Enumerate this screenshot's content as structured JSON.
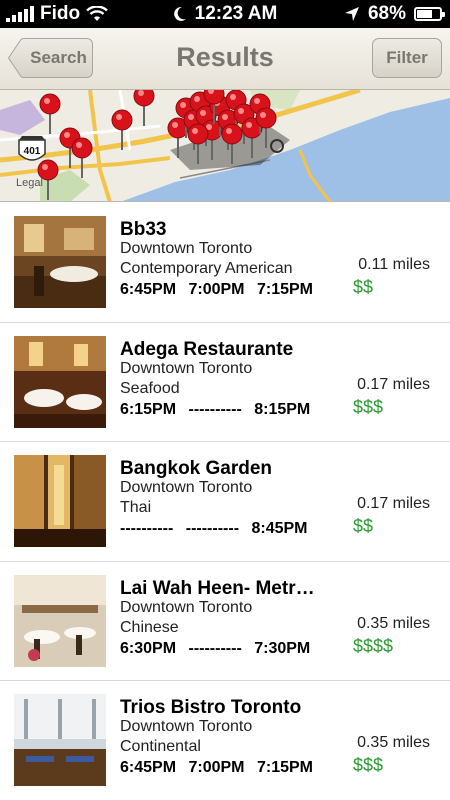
{
  "status_bar": {
    "carrier": "Fido",
    "time": "12:23 AM",
    "battery": "68%",
    "battery_level": 0.68
  },
  "nav": {
    "back_label": "Search",
    "title": "Results",
    "filter_label": "Filter"
  },
  "map": {
    "highway_label": "401",
    "legal_label": "Legal"
  },
  "results": [
    {
      "name": "Bb33",
      "area": "Downtown Toronto",
      "cuisine": "Contemporary American",
      "times": [
        "6:45PM",
        "7:00PM",
        "7:15PM"
      ],
      "distance": "0.11 miles",
      "price": "$$"
    },
    {
      "name": "Adega Restaurante",
      "area": "Downtown Toronto",
      "cuisine": "Seafood",
      "times": [
        "6:15PM",
        "----------",
        "8:15PM"
      ],
      "distance": "0.17 miles",
      "price": "$$$"
    },
    {
      "name": "Bangkok Garden",
      "area": "Downtown Toronto",
      "cuisine": "Thai",
      "times": [
        "----------",
        "----------",
        "8:45PM"
      ],
      "distance": "0.17 miles",
      "price": "$$"
    },
    {
      "name": "Lai Wah Heen- Metr…",
      "area": "Downtown Toronto",
      "cuisine": "Chinese",
      "times": [
        "6:30PM",
        "----------",
        "7:30PM"
      ],
      "distance": "0.35 miles",
      "price": "$$$$"
    },
    {
      "name": "Trios Bistro Toronto",
      "area": "Downtown Toronto",
      "cuisine": "Continental",
      "times": [
        "6:45PM",
        "7:00PM",
        "7:15PM"
      ],
      "distance": "0.35 miles",
      "price": "$$$"
    }
  ],
  "colors": {
    "price_green": "#2b9a33",
    "pin_red": "#d8121b",
    "water_blue": "#9fc0e6"
  }
}
